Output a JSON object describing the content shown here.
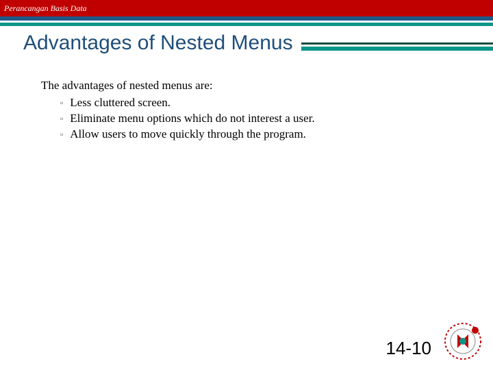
{
  "header": {
    "course_label": "Perancangan Basis Data"
  },
  "slide": {
    "title": "Advantages of Nested Menus",
    "intro": "The advantages of nested menus are:",
    "bullets": [
      "Less cluttered screen.",
      "Eliminate menu options which do not interest a user.",
      "Allow users to move quickly through the program."
    ],
    "page_number": "14-10"
  },
  "logo": {
    "name": "university-logo"
  }
}
